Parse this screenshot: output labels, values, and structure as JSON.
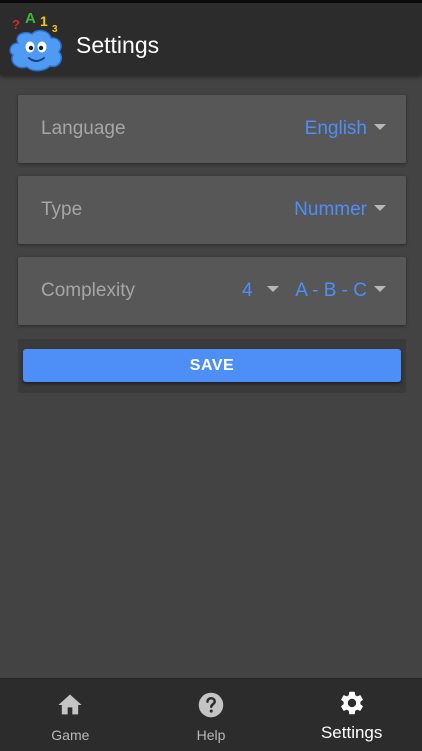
{
  "header": {
    "title": "Settings",
    "logo_icon": "blob-mascot-logo",
    "logo_letters": [
      "?",
      "A",
      "1",
      "3"
    ]
  },
  "settings": {
    "language": {
      "label": "Language",
      "value": "English"
    },
    "type": {
      "label": "Type",
      "value": "Nummer"
    },
    "complexity": {
      "label": "Complexity",
      "level": "4",
      "pattern": "A - B - C"
    }
  },
  "actions": {
    "save_label": "SAVE"
  },
  "bottom_nav": {
    "items": [
      {
        "label": "Game",
        "icon": "home-icon",
        "active": false
      },
      {
        "label": "Help",
        "icon": "help-icon",
        "active": false
      },
      {
        "label": "Settings",
        "icon": "gear-icon",
        "active": true
      }
    ]
  },
  "colors": {
    "accent": "#4d8ef7",
    "background": "#434343",
    "card": "#575757",
    "bar": "#2c2c2c"
  }
}
